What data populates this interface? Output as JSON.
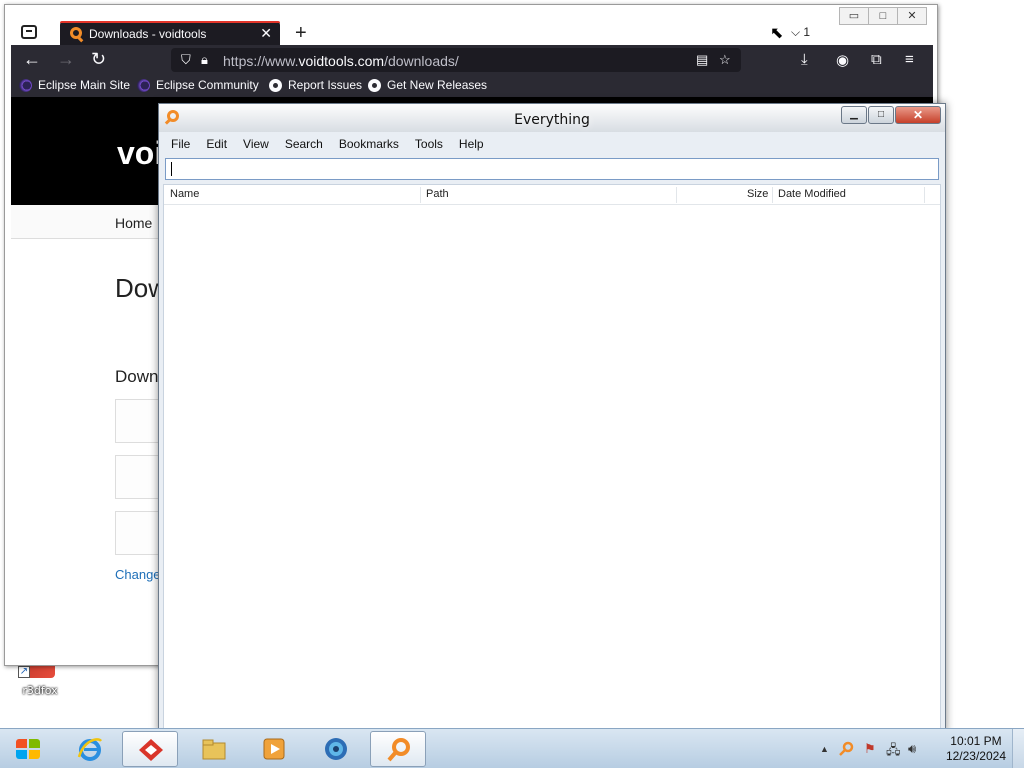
{
  "desktop": {
    "icon_label": "r3dfox"
  },
  "browser": {
    "tab_title": "Downloads - voidtools",
    "tab_close": "✕",
    "new_tab": "+",
    "window_controls": [
      "▭",
      "□",
      "✕"
    ],
    "downloads_indicator": "⌵ 1",
    "url_prefix": "https://www.",
    "url_host": "voidtools.com",
    "url_path": "/downloads/",
    "bookmarks": [
      {
        "label": "Eclipse Main Site",
        "icon": "eclipse-icon"
      },
      {
        "label": "Eclipse Community",
        "icon": "eclipse-icon"
      },
      {
        "label": "Report Issues",
        "icon": "github-icon"
      },
      {
        "label": "Get New Releases",
        "icon": "github-icon"
      }
    ],
    "page": {
      "logo": "voi",
      "nav_home": "Home",
      "heading": "Dow",
      "subheading": "Down",
      "link": "Changes"
    }
  },
  "everything": {
    "title": "Everything",
    "menu": [
      "File",
      "Edit",
      "View",
      "Search",
      "Bookmarks",
      "Tools",
      "Help"
    ],
    "search_value": "",
    "columns": [
      "Name",
      "Path",
      "Size",
      "Date Modified"
    ],
    "controls": [
      "▁",
      "□",
      "✕"
    ]
  },
  "taskbar": {
    "time": "10:01 PM",
    "date": "12/23/2024",
    "tray_arrow": "▲",
    "colors": {
      "accent": "#f28c28",
      "brand_red": "#e2352a"
    }
  }
}
